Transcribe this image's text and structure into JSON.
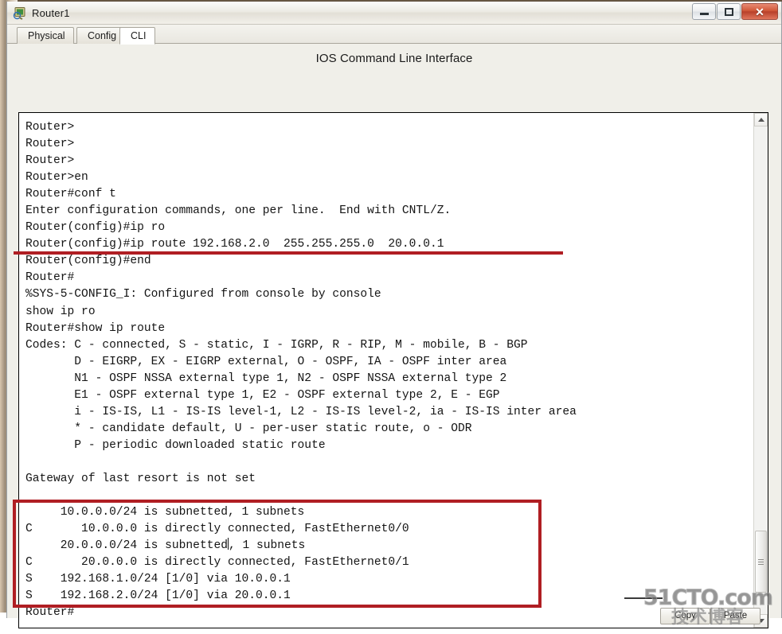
{
  "window": {
    "title": "Router1",
    "icon": "router-device-icon",
    "buttons": {
      "minimize": "–",
      "maximize": "❐",
      "close": "✕"
    }
  },
  "tabs": [
    {
      "label": "Physical",
      "active": false
    },
    {
      "label": "Config",
      "active": false
    },
    {
      "label": "CLI",
      "active": true
    }
  ],
  "panel": {
    "title": "IOS Command Line Interface"
  },
  "console": {
    "lines": [
      "Router>",
      "Router>",
      "Router>",
      "Router>en",
      "Router#conf t",
      "Enter configuration commands, one per line.  End with CNTL/Z.",
      "Router(config)#ip ro",
      "Router(config)#ip route 192.168.2.0  255.255.255.0  20.0.0.1",
      "Router(config)#end",
      "Router#",
      "%SYS-5-CONFIG_I: Configured from console by console",
      "show ip ro",
      "Router#show ip route",
      "Codes: C - connected, S - static, I - IGRP, R - RIP, M - mobile, B - BGP",
      "       D - EIGRP, EX - EIGRP external, O - OSPF, IA - OSPF inter area",
      "       N1 - OSPF NSSA external type 1, N2 - OSPF NSSA external type 2",
      "       E1 - OSPF external type 1, E2 - OSPF external type 2, E - EGP",
      "       i - IS-IS, L1 - IS-IS level-1, L2 - IS-IS level-2, ia - IS-IS inter area",
      "       * - candidate default, U - per-user static route, o - ODR",
      "       P - periodic downloaded static route",
      "",
      "Gateway of last resort is not set",
      "",
      "     10.0.0.0/24 is subnetted, 1 subnets",
      "C       10.0.0.0 is directly connected, FastEthernet0/0",
      "     20.0.0.0/24 is subnetted, 1 subnets",
      "C       20.0.0.0 is directly connected, FastEthernet0/1",
      "S    192.168.1.0/24 [1/0] via 10.0.0.1",
      "S    192.168.2.0/24 [1/0] via 20.0.0.1",
      "Router#"
    ],
    "caret_line_index": 25,
    "caret_after_text": "     20.0.0.0/24 is subnetted"
  },
  "annotations": {
    "color": "#b01e23",
    "underline_target": "Router(config)#ip route 192.168.2.0  255.255.255.0  20.0.0.1",
    "box_target": "routing-table-entries"
  },
  "actions": [
    {
      "label": "Copy"
    },
    {
      "label": "Paste"
    }
  ],
  "watermark": {
    "english": "51CTO.com",
    "chinese": "技术博客"
  },
  "scrollbar": {
    "up_arrow": "▲",
    "down_arrow": "▼"
  }
}
